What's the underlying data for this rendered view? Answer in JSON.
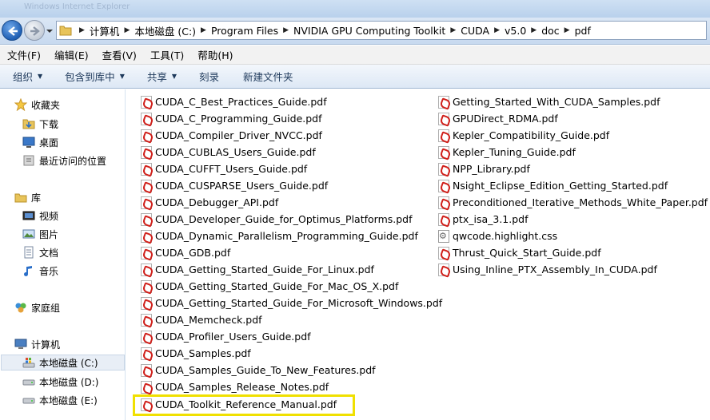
{
  "window": {
    "title_faded": "Windows Internet Explorer"
  },
  "address": {
    "crumbs": [
      "计算机",
      "本地磁盘 (C:)",
      "Program Files",
      "NVIDIA GPU Computing Toolkit",
      "CUDA",
      "v5.0",
      "doc",
      "pdf"
    ]
  },
  "menu": [
    "文件(F)",
    "编辑(E)",
    "查看(V)",
    "工具(T)",
    "帮助(H)"
  ],
  "toolbar": {
    "organize": "组织",
    "include_in_library": "包含到库中",
    "share": "共享",
    "burn": "刻录",
    "new_folder": "新建文件夹"
  },
  "sidebar": {
    "favorites": "收藏夹",
    "downloads": "下载",
    "desktop": "桌面",
    "recent": "最近访问的位置",
    "libraries": "库",
    "videos": "视频",
    "pictures": "图片",
    "documents": "文档",
    "music": "音乐",
    "homegroup": "家庭组",
    "computer": "计算机",
    "drive_c": "本地磁盘 (C:)",
    "drive_d": "本地磁盘 (D:)",
    "drive_e": "本地磁盘 (E:)"
  },
  "files_col1": [
    "CUDA_C_Best_Practices_Guide.pdf",
    "CUDA_C_Programming_Guide.pdf",
    "CUDA_Compiler_Driver_NVCC.pdf",
    "CUDA_CUBLAS_Users_Guide.pdf",
    "CUDA_CUFFT_Users_Guide.pdf",
    "CUDA_CUSPARSE_Users_Guide.pdf",
    "CUDA_Debugger_API.pdf",
    "CUDA_Developer_Guide_for_Optimus_Platforms.pdf",
    "CUDA_Dynamic_Parallelism_Programming_Guide.pdf",
    "CUDA_GDB.pdf",
    "CUDA_Getting_Started_Guide_For_Linux.pdf",
    "CUDA_Getting_Started_Guide_For_Mac_OS_X.pdf",
    "CUDA_Getting_Started_Guide_For_Microsoft_Windows.pdf",
    "CUDA_Memcheck.pdf",
    "CUDA_Profiler_Users_Guide.pdf",
    "CUDA_Samples.pdf",
    "CUDA_Samples_Guide_To_New_Features.pdf",
    "CUDA_Samples_Release_Notes.pdf",
    "CUDA_Toolkit_Reference_Manual.pdf"
  ],
  "files_col2": [
    "Getting_Started_With_CUDA_Samples.pdf",
    "GPUDirect_RDMA.pdf",
    "Kepler_Compatibility_Guide.pdf",
    "Kepler_Tuning_Guide.pdf",
    "NPP_Library.pdf",
    "Nsight_Eclipse_Edition_Getting_Started.pdf",
    "Preconditioned_Iterative_Methods_White_Paper.pdf",
    "ptx_isa_3.1.pdf",
    "qwcode.highlight.css",
    "Thrust_Quick_Start_Guide.pdf",
    "Using_Inline_PTX_Assembly_In_CUDA.pdf"
  ],
  "colors": {
    "highlight": "#f0e000",
    "toolbar_text": "#1e395b"
  }
}
